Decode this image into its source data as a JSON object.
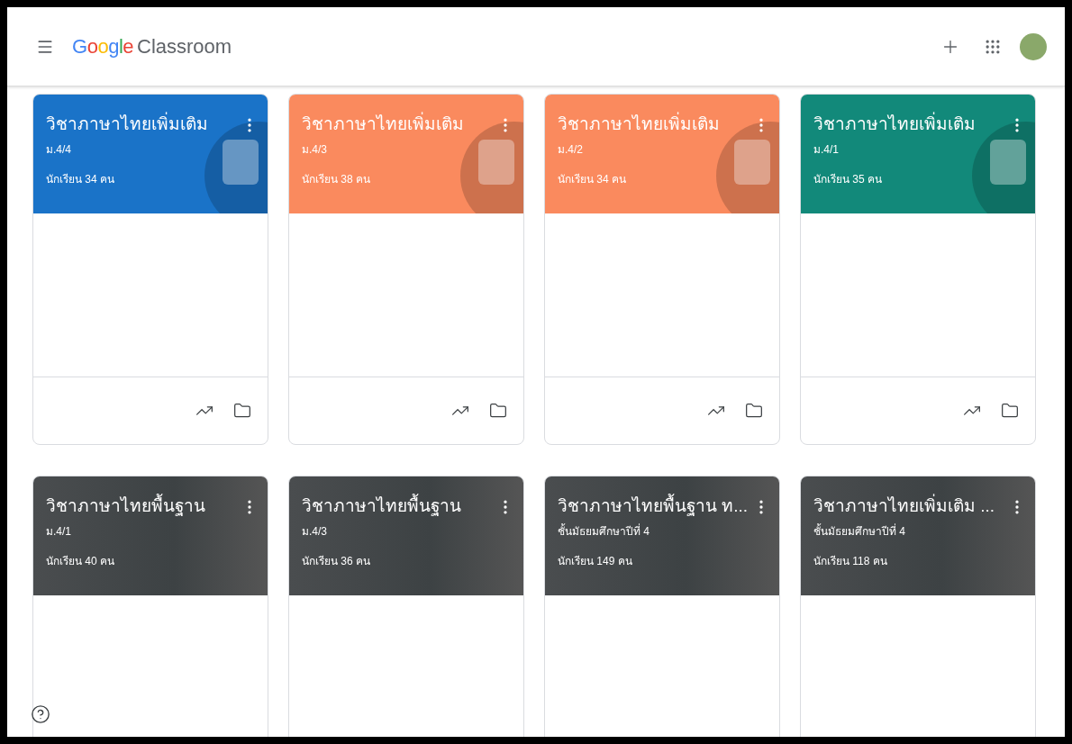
{
  "app_bar": {
    "logo_brand": "Google",
    "logo_product": "Classroom"
  },
  "classes": [
    {
      "kind": "illustration",
      "color": "#1a73c8",
      "title": "วิชาภาษาไทยเพิ่มเติม",
      "section": "ม.4/4",
      "students": "นักเรียน 34 คน"
    },
    {
      "kind": "illustration",
      "color": "#fa8a5e",
      "title": "วิชาภาษาไทยเพิ่มเติม",
      "section": "ม.4/3",
      "students": "นักเรียน 38 คน"
    },
    {
      "kind": "illustration",
      "color": "#fa8a5e",
      "title": "วิชาภาษาไทยเพิ่มเติม",
      "section": "ม.4/2",
      "students": "นักเรียน 34 คน"
    },
    {
      "kind": "illustration",
      "color": "#12897a",
      "title": "วิชาภาษาไทยเพิ่มเติม",
      "section": "ม.4/1",
      "students": "นักเรียน 35 คน"
    },
    {
      "kind": "photo",
      "title": "วิชาภาษาไทยพื้นฐาน",
      "section": "ม.4/1",
      "students": "นักเรียน 40 คน"
    },
    {
      "kind": "photo",
      "title": "วิชาภาษาไทยพื้นฐาน",
      "section": "ม.4/3",
      "students": "นักเรียน 36 คน"
    },
    {
      "kind": "photo",
      "title": "วิชาภาษาไทยพื้นฐาน ท...",
      "section": "ชั้นมัธยมศึกษาปีที่ 4",
      "students": "นักเรียน 149 คน"
    },
    {
      "kind": "photo",
      "title": "วิชาภาษาไทยเพิ่มเติม ...",
      "section": "ชั้นมัธยมศึกษาปีที่ 4",
      "students": "นักเรียน 118 คน"
    }
  ]
}
